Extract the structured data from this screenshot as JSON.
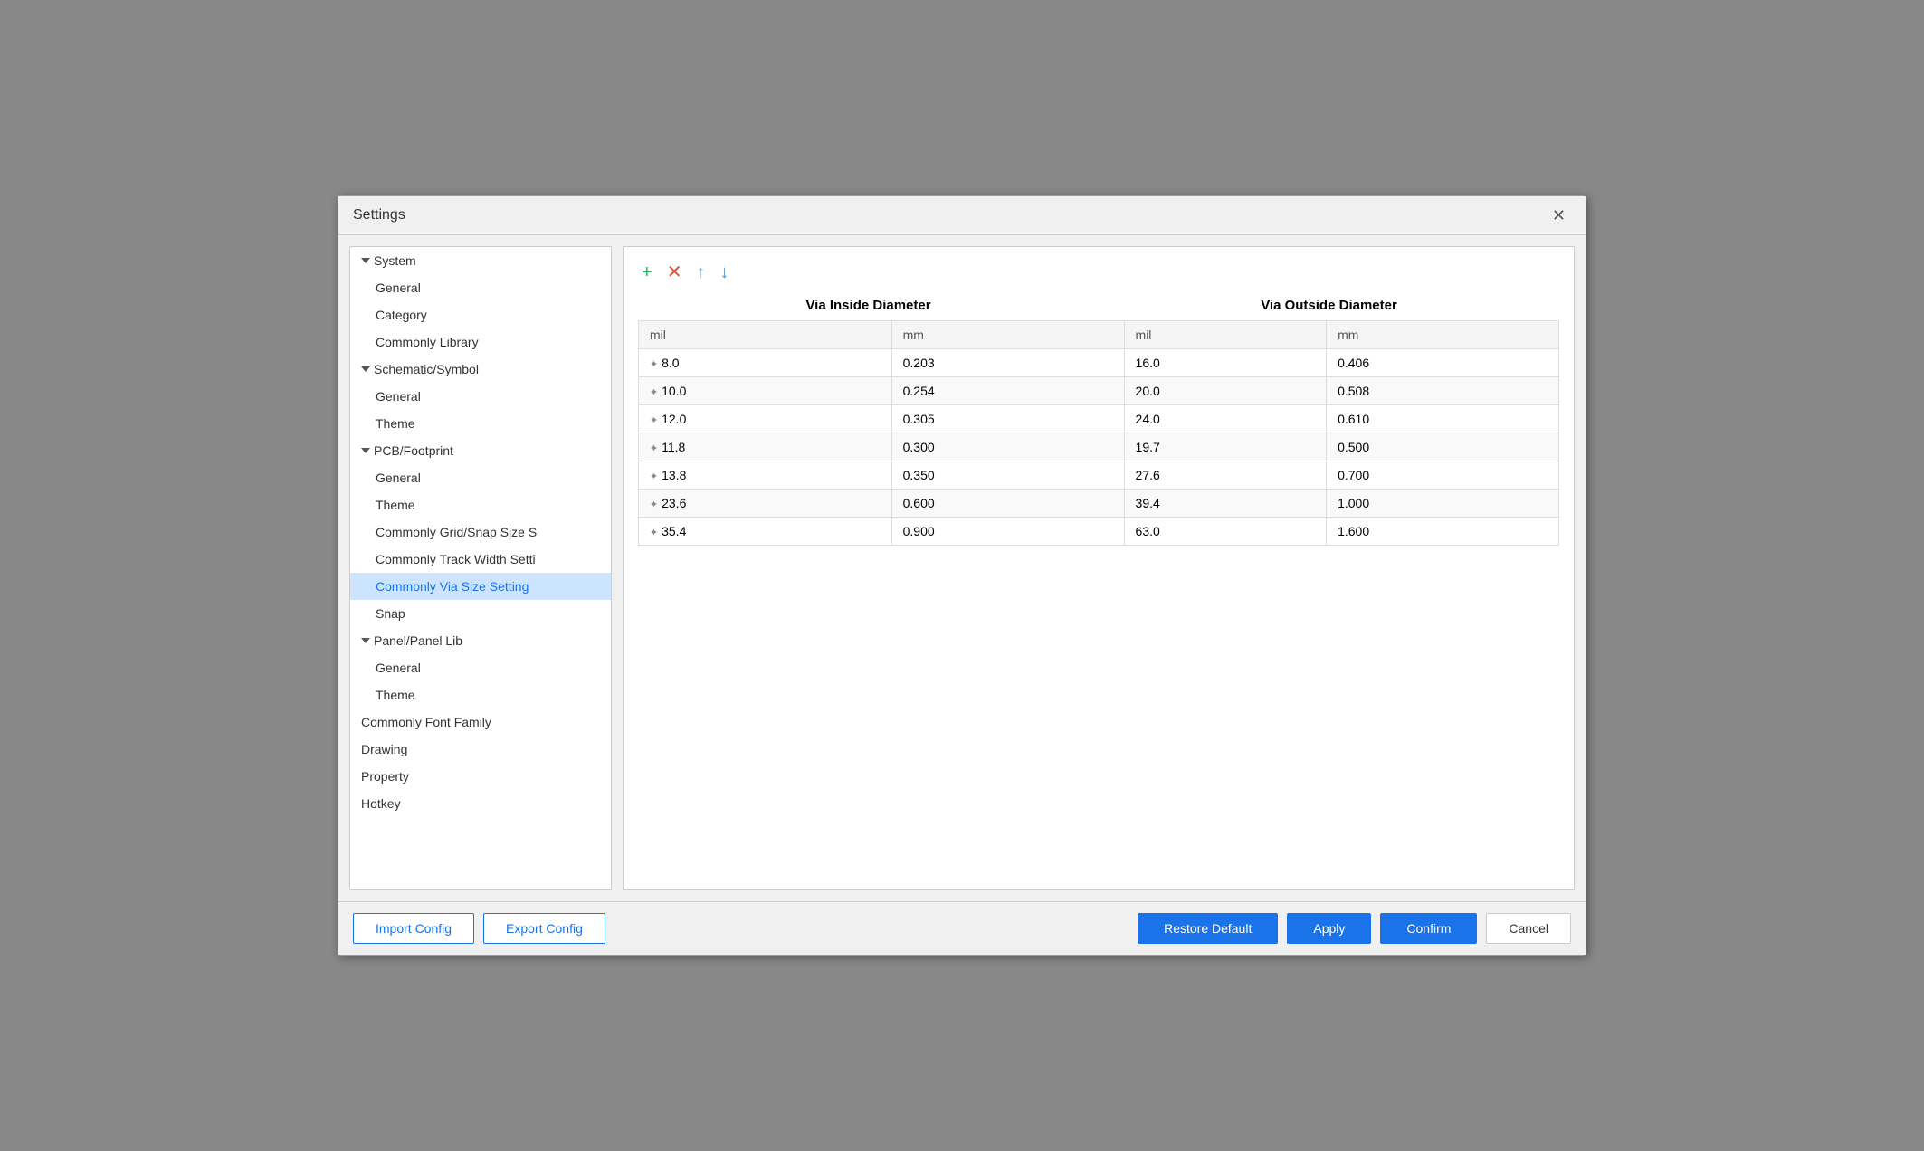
{
  "dialog": {
    "title": "Settings",
    "close_label": "✕"
  },
  "sidebar": {
    "items": [
      {
        "id": "system",
        "label": "System",
        "type": "group",
        "level": 0
      },
      {
        "id": "system-general",
        "label": "General",
        "type": "child",
        "level": 1
      },
      {
        "id": "system-category",
        "label": "Category",
        "type": "child",
        "level": 1
      },
      {
        "id": "system-commonly-library",
        "label": "Commonly Library",
        "type": "child",
        "level": 1
      },
      {
        "id": "schematic-symbol",
        "label": "Schematic/Symbol",
        "type": "group",
        "level": 0
      },
      {
        "id": "schematic-general",
        "label": "General",
        "type": "child",
        "level": 1
      },
      {
        "id": "schematic-theme",
        "label": "Theme",
        "type": "child",
        "level": 1
      },
      {
        "id": "pcb-footprint",
        "label": "PCB/Footprint",
        "type": "group",
        "level": 0
      },
      {
        "id": "pcb-general",
        "label": "General",
        "type": "child",
        "level": 1
      },
      {
        "id": "pcb-theme",
        "label": "Theme",
        "type": "child",
        "level": 1
      },
      {
        "id": "pcb-grid-snap",
        "label": "Commonly Grid/Snap Size S",
        "type": "child",
        "level": 1
      },
      {
        "id": "pcb-track-width",
        "label": "Commonly Track Width Setti",
        "type": "child",
        "level": 1
      },
      {
        "id": "pcb-via-size",
        "label": "Commonly Via Size Setting",
        "type": "child",
        "level": 1,
        "active": true
      },
      {
        "id": "pcb-snap",
        "label": "Snap",
        "type": "child",
        "level": 1
      },
      {
        "id": "panel-lib",
        "label": "Panel/Panel Lib",
        "type": "group",
        "level": 0
      },
      {
        "id": "panel-general",
        "label": "General",
        "type": "child",
        "level": 1
      },
      {
        "id": "panel-theme",
        "label": "Theme",
        "type": "child",
        "level": 1
      },
      {
        "id": "commonly-font",
        "label": "Commonly Font Family",
        "type": "top-child",
        "level": 0
      },
      {
        "id": "drawing",
        "label": "Drawing",
        "type": "top-child",
        "level": 0
      },
      {
        "id": "property",
        "label": "Property",
        "type": "top-child",
        "level": 0
      },
      {
        "id": "hotkey",
        "label": "Hotkey",
        "type": "top-child",
        "level": 0
      }
    ]
  },
  "toolbar": {
    "add_label": "+",
    "remove_label": "✕",
    "up_label": "↑",
    "down_label": "↓"
  },
  "content": {
    "via_inside_diameter": "Via Inside Diameter",
    "via_outside_diameter": "Via Outside Diameter",
    "col_headers": [
      "mil",
      "mm",
      "mil",
      "mm"
    ],
    "rows": [
      {
        "inside_mil": "8.0",
        "inside_mm": "0.203",
        "outside_mil": "16.0",
        "outside_mm": "0.406"
      },
      {
        "inside_mil": "10.0",
        "inside_mm": "0.254",
        "outside_mil": "20.0",
        "outside_mm": "0.508"
      },
      {
        "inside_mil": "12.0",
        "inside_mm": "0.305",
        "outside_mil": "24.0",
        "outside_mm": "0.610"
      },
      {
        "inside_mil": "11.8",
        "inside_mm": "0.300",
        "outside_mil": "19.7",
        "outside_mm": "0.500"
      },
      {
        "inside_mil": "13.8",
        "inside_mm": "0.350",
        "outside_mil": "27.6",
        "outside_mm": "0.700"
      },
      {
        "inside_mil": "23.6",
        "inside_mm": "0.600",
        "outside_mil": "39.4",
        "outside_mm": "1.000"
      },
      {
        "inside_mil": "35.4",
        "inside_mm": "0.900",
        "outside_mil": "63.0",
        "outside_mm": "1.600"
      }
    ]
  },
  "footer": {
    "import_config": "Import Config",
    "export_config": "Export Config",
    "restore_default": "Restore Default",
    "apply": "Apply",
    "confirm": "Confirm",
    "cancel": "Cancel"
  }
}
